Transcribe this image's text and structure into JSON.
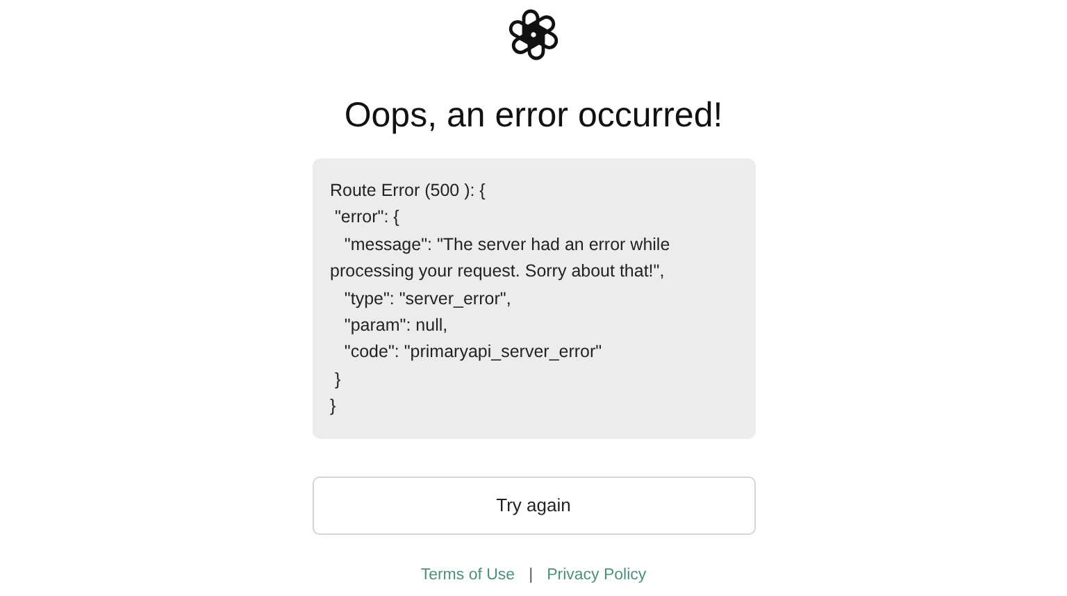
{
  "heading": "Oops, an error occurred!",
  "error_lines": [
    "Route Error (500 ): {",
    " \"error\": {",
    "   \"message\": \"The server had an error while",
    "processing your request. Sorry about that!\",",
    "   \"type\": \"server_error\",",
    "   \"param\": null,",
    "   \"code\": \"primaryapi_server_error\"",
    " }",
    "}"
  ],
  "button": "Try again",
  "footer_links": [
    "Terms of Use",
    "Privacy Policy"
  ],
  "separator": "|"
}
